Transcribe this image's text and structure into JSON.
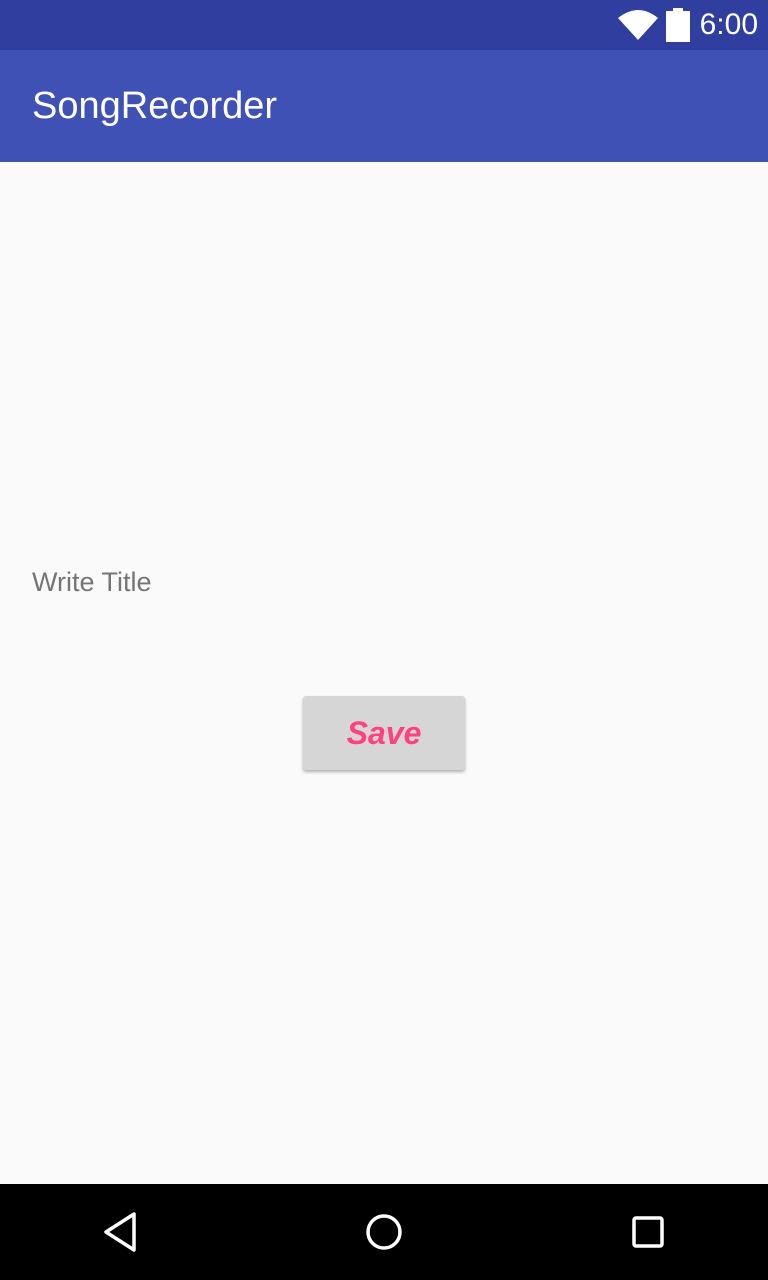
{
  "status_bar": {
    "time": "6:00",
    "icons": [
      "wifi-icon",
      "battery-icon"
    ],
    "background": "#303f9f"
  },
  "app_bar": {
    "title": "SongRecorder",
    "background": "#3f51b5"
  },
  "form": {
    "title_input": {
      "value": "",
      "placeholder": "Write Title"
    },
    "save_label": "Save",
    "save_color": "#ff4081"
  },
  "nav_bar": {
    "buttons": [
      "back-icon",
      "home-icon",
      "recents-icon"
    ],
    "background": "#000000"
  }
}
